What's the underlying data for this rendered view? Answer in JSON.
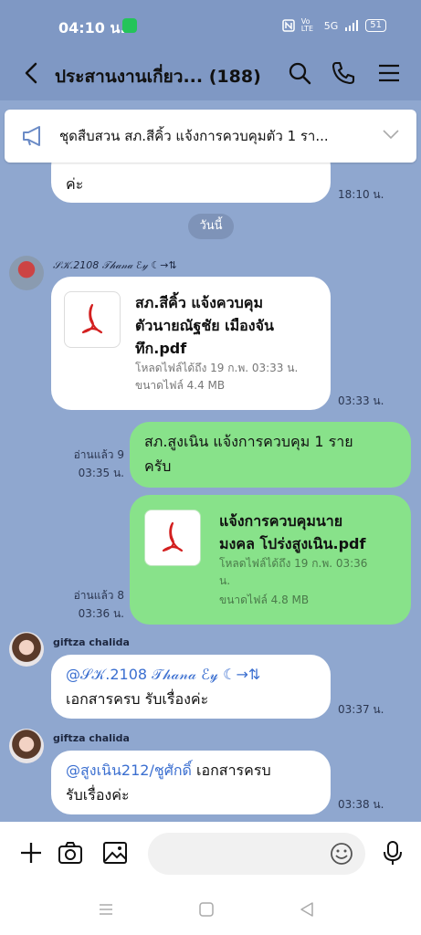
{
  "status": {
    "time": "04:10 น.",
    "signal": "5G",
    "lte": "Vo LTE",
    "battery": "51"
  },
  "header": {
    "title": "ประสานงานเกี่ยว... (188)"
  },
  "announcement": {
    "text": "ชุดสืบสวน สภ.สีคิ้ว แจ้งการควบคุมตัว 1 รา..."
  },
  "messages": [
    {
      "id": "m0",
      "text_top": "@...",
      "text": "ค่ะ",
      "time": "18:10 น."
    },
    {
      "id": "date",
      "text": "วันนี้"
    },
    {
      "id": "m1",
      "sender": "𝒮𝒦.2108 𝒯𝒽𝒶𝓃𝒶 ℰ𝓎 ☾→⇅",
      "file_name": "สภ.สีคิ้ว แจ้งควบคุมตัวนายณัฐชัย เมืองจันทึก.pdf",
      "file_name_lines": [
        "สภ.สีคิ้ว แจ้งควบคุม",
        "ตัวนายณัฐชัย เมืองจัน",
        "ทึก.pdf"
      ],
      "expiry": "โหลดไฟล์ได้ถึง 19 ก.พ. 03:33 น.",
      "size": "ขนาดไฟล์ 4.4 MB",
      "time": "03:33 น."
    },
    {
      "id": "m2",
      "mine": true,
      "text_lines": [
        "สภ.สูงเนิน  แจ้งการควบคุม 1 ราย",
        "ครับ"
      ],
      "read": "อ่านแล้ว 9",
      "time": "03:35 น."
    },
    {
      "id": "m3",
      "mine": true,
      "file_name_lines": [
        "แจ้งการควบคุมนาย",
        "มงคล โปร่งสูงเนิน.pdf"
      ],
      "expiry_lines": [
        "โหลดไฟล์ได้ถึง 19 ก.พ. 03:36",
        "น."
      ],
      "size": "ขนาดไฟล์ 4.8 MB",
      "read": "อ่านแล้ว 8",
      "time": "03:36 น."
    },
    {
      "id": "m4",
      "sender": "giftza chalida",
      "mention": "@𝒮𝒦.2108 𝒯𝒽𝒶𝓃𝒶 ℰ𝓎 ☾→⇅",
      "text": "เอกสารครบ รับเรื่องค่ะ",
      "time": "03:37 น."
    },
    {
      "id": "m5",
      "sender": "giftza chalida",
      "mention": "@สูงเนิน212/ชูศักดิ์",
      "text_after_mention": " เอกสารครบ",
      "text": "รับเรื่องค่ะ",
      "time": "03:38 น."
    }
  ],
  "input": {
    "placeholder": ""
  },
  "colors": {
    "chat_bg": "#8fa7cf",
    "header_bg": "#7f98c4",
    "mine_bubble": "#88e28a",
    "other_bubble": "#ffffff",
    "mention": "#3b6fd0",
    "pdf_red": "#d32020"
  },
  "icons": [
    "back-arrow-icon",
    "search-icon",
    "phone-icon",
    "menu-icon",
    "megaphone-icon",
    "chevron-down-icon",
    "pdf-icon",
    "plus-icon",
    "camera-icon",
    "image-icon",
    "emoji-icon",
    "mic-icon",
    "nav-menu-icon",
    "nav-home-icon",
    "nav-back-icon"
  ]
}
